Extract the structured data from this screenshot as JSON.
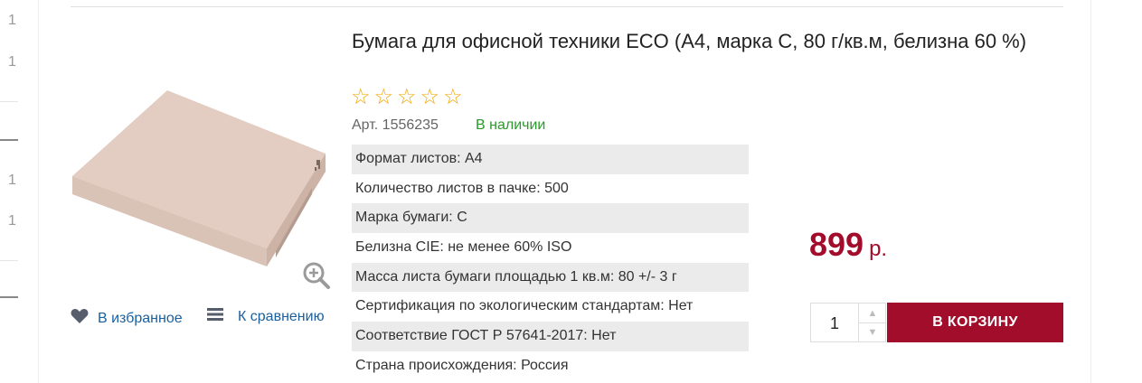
{
  "left_rail": {
    "numbers": [
      "1",
      "1",
      "1",
      "1"
    ]
  },
  "product": {
    "title": "Бумага для офисной техники ECO (А4, марка С, 80 г/кв.м, белизна 60 %)",
    "rating": {
      "value": 0,
      "max": 5,
      "icon": "star-outline-icon"
    },
    "article": "Арт. 1556235",
    "availability": "В наличии",
    "specs": [
      "Формат листов: А4",
      "Количество листов в пачке: 500",
      "Марка бумаги: С",
      "Белизна CIE: не менее 60% ISO",
      "Масса листа бумаги площадью 1 кв.м: 80 +/- 3 г",
      "Сертификация по экологическим стандартам: Нет",
      "Соответствие ГОСТ Р 57641-2017: Нет",
      "Страна происхождения: Россия"
    ],
    "price": {
      "value": "899",
      "currency": "р."
    },
    "quantity": "1",
    "add_to_cart": "В КОРЗИНУ",
    "favorites": "В избранное",
    "compare": "К сравнению"
  },
  "colors": {
    "accent": "#a30d2c",
    "link": "#1a5f9e",
    "in_stock": "#2a9a2a",
    "star": "#f0a500"
  }
}
